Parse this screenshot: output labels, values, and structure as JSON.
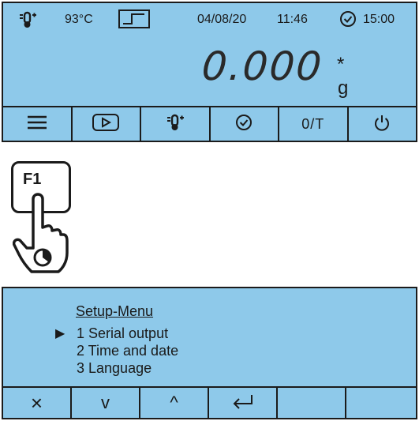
{
  "status_bar": {
    "temperature": "93°C",
    "date": "04/08/20",
    "time": "11:46",
    "timer": "15:00"
  },
  "weight": {
    "value": "0.000",
    "stability_mark": "*",
    "unit": "g"
  },
  "softkeys": {
    "tare_label": "0/T"
  },
  "f1_key": {
    "label": "F1"
  },
  "setup_menu": {
    "title": "Setup-Menu",
    "selected_index": 0,
    "items": [
      "1 Serial output",
      "2 Time and date",
      "3 Language"
    ]
  },
  "menu_softkeys": {
    "symbols": [
      "×",
      "v",
      "^"
    ]
  },
  "icons": [
    "thermometer-icon",
    "step-signal-icon",
    "clock-check-icon",
    "menu-icon",
    "play-icon",
    "clock-icon",
    "power-icon",
    "enter-icon",
    "finger-press-icon"
  ],
  "colors": {
    "display_background": "#8ec9ea",
    "ink": "#1b1b1b"
  }
}
